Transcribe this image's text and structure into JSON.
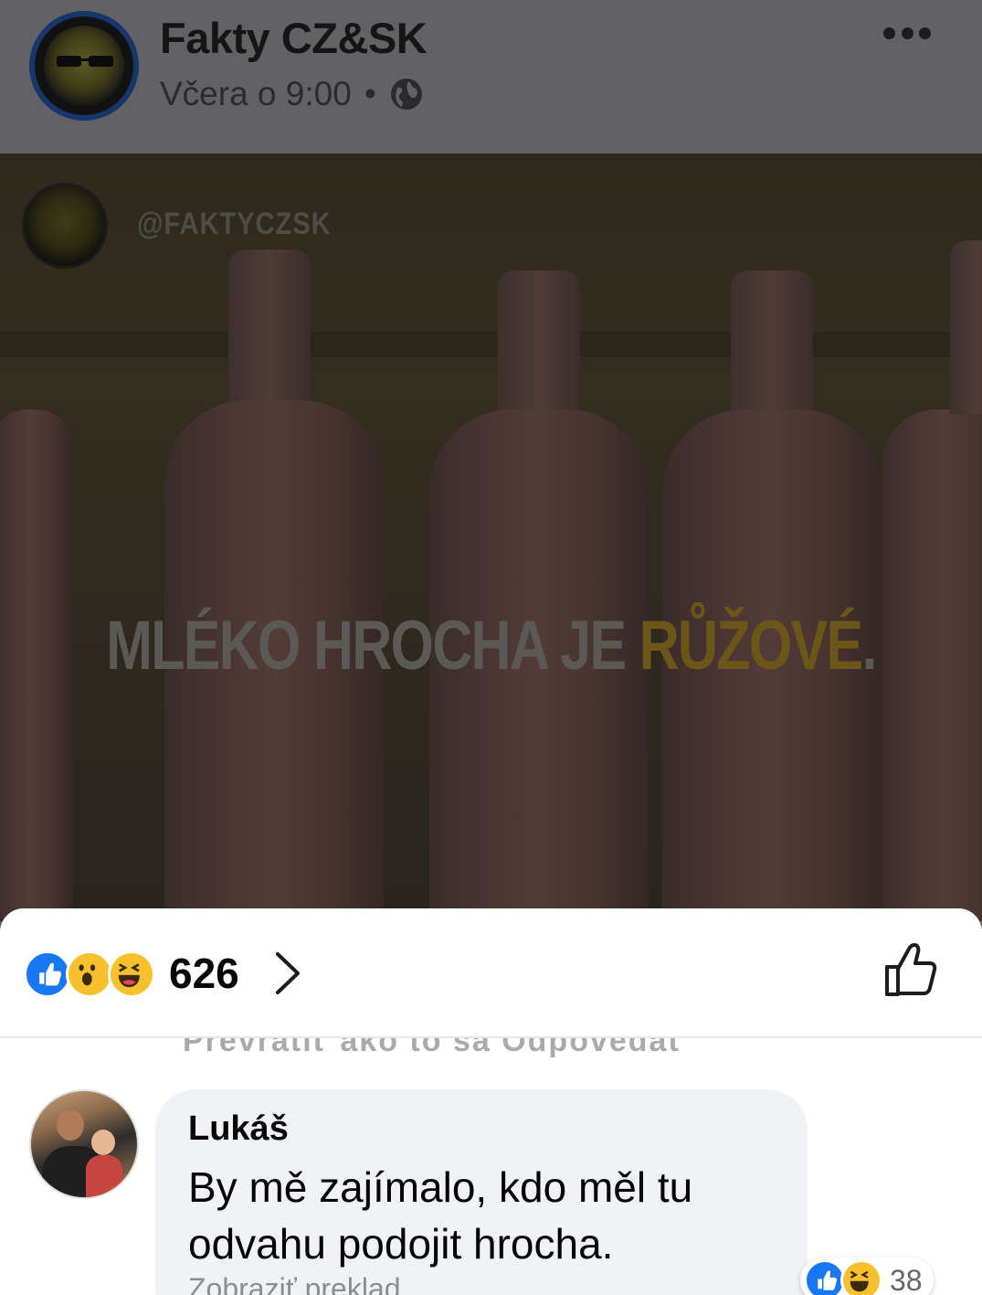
{
  "post": {
    "page_name": "Fakty CZ&SK",
    "timestamp": "Včera o 9:00",
    "separator": "•",
    "privacy_icon": "globe-icon",
    "menu_icon": "more-dots-icon"
  },
  "image": {
    "watermark": "@FAKTYCZSK",
    "caption_main": "MLÉKO HROCHA JE ",
    "caption_highlight": "RŮŽOVÉ",
    "caption_end": "."
  },
  "reactions": {
    "icons": [
      "like-icon",
      "wow-icon",
      "haha-icon"
    ],
    "count": "626",
    "like_button_icon": "thumbs-up-outline-icon",
    "colors": {
      "like": "#1877f2",
      "emoji": "#f7c12d"
    }
  },
  "partial_row": {
    "text": "Prevrátiť ako to sa  Odpovedať"
  },
  "comment": {
    "author": "Lukáš",
    "text": "By mě zajímalo, kdo měl tu odvahu podojit hrocha.",
    "translate": "Zobraziť preklad",
    "reaction_count": "38",
    "reaction_icons": [
      "like-icon",
      "haha-icon"
    ]
  }
}
